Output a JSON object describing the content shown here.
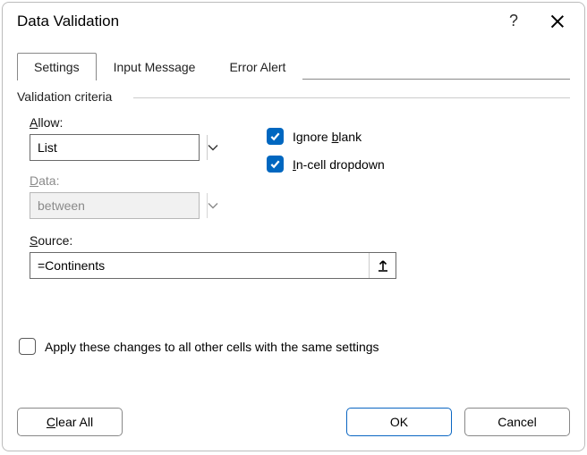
{
  "window": {
    "title": "Data Validation"
  },
  "tabs": [
    {
      "label": "Settings",
      "active": true
    },
    {
      "label": "Input Message",
      "active": false
    },
    {
      "label": "Error Alert",
      "active": false
    }
  ],
  "group": {
    "legend": "Validation criteria"
  },
  "labels": {
    "allow": "Allow:",
    "data": "Data:",
    "source": "Source:",
    "ignore_blank": "Ignore blank",
    "incell_dropdown": "In-cell dropdown",
    "apply_all": "Apply these changes to all other cells with the same settings"
  },
  "fields": {
    "allow": {
      "value": "List",
      "enabled": true
    },
    "data": {
      "value": "between",
      "enabled": false
    },
    "source": {
      "value": "=Continents"
    }
  },
  "checks": {
    "ignore_blank": true,
    "incell_dropdown": true,
    "apply_all": false
  },
  "buttons": {
    "clear_all": "Clear All",
    "ok": "OK",
    "cancel": "Cancel"
  },
  "hotkeys": {
    "allow": "A",
    "data": "D",
    "source": "S",
    "ignore_blank": "b",
    "incell_dropdown": "I",
    "clear_all": "C"
  }
}
